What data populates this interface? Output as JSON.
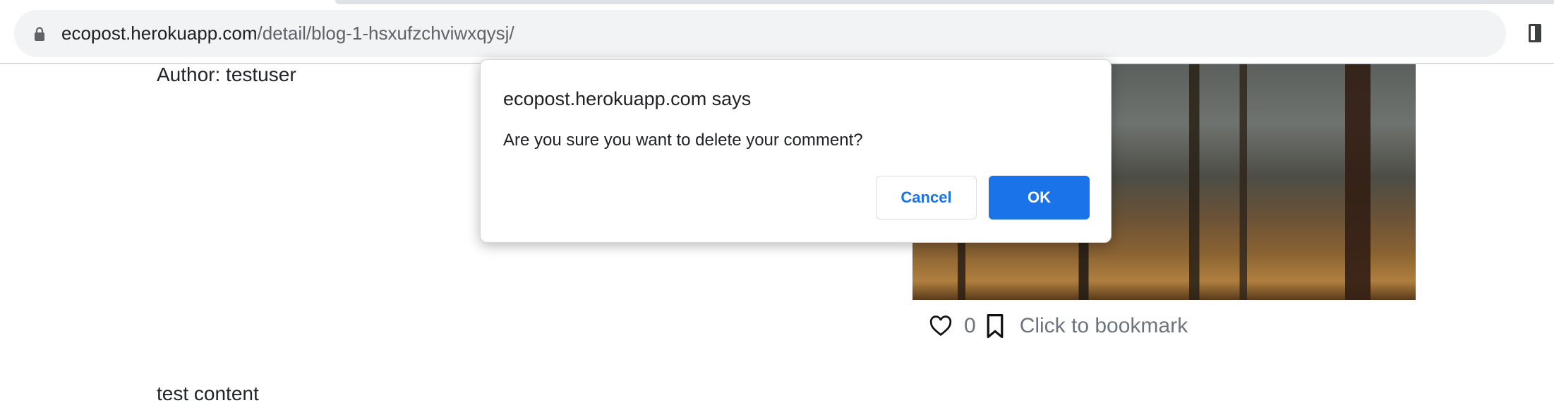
{
  "browser": {
    "url_host": "ecopost.herokuapp.com",
    "url_path": "/detail/blog-1-hsxufzchviwxqysj/",
    "icons": [
      "lock-icon",
      "side-panel-icon"
    ]
  },
  "post": {
    "author": "Author: testuser",
    "content": "test content",
    "like_count": "0",
    "bookmark_label": "Click to bookmark",
    "icons": [
      "heart-icon",
      "bookmark-icon"
    ]
  },
  "dialog": {
    "title": "ecopost.herokuapp.com says",
    "message": "Are you sure you want to delete your comment?",
    "cancel_label": "Cancel",
    "ok_label": "OK",
    "accent_color": "#1a73e8"
  }
}
